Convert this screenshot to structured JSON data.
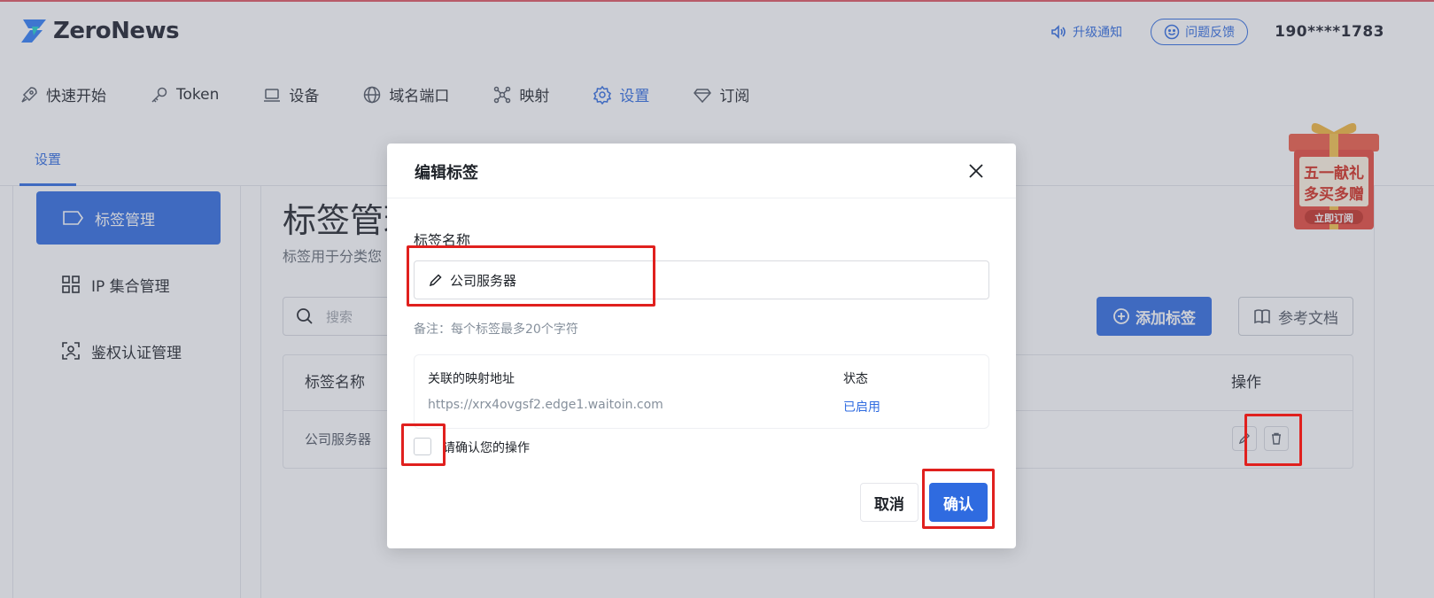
{
  "app": {
    "name": "ZeroNews"
  },
  "header": {
    "notice_label": "升级通知",
    "feedback_label": "问题反馈",
    "user_phone": "190****1783"
  },
  "nav": {
    "items": [
      {
        "label": "快速开始",
        "icon": "rocket-icon"
      },
      {
        "label": "Token",
        "icon": "key-icon"
      },
      {
        "label": "设备",
        "icon": "laptop-icon"
      },
      {
        "label": "域名端口",
        "icon": "globe-icon"
      },
      {
        "label": "映射",
        "icon": "network-icon"
      },
      {
        "label": "设置",
        "icon": "gear-icon",
        "active": true
      },
      {
        "label": "订阅",
        "icon": "diamond-icon"
      }
    ]
  },
  "subnav": {
    "tab": "设置"
  },
  "promo": {
    "line1": "五一献礼",
    "line2": "多买多赠",
    "cta": "立即订阅"
  },
  "sidebar": {
    "items": [
      {
        "label": "标签管理",
        "icon": "tag-icon",
        "active": true
      },
      {
        "label": "IP 集合管理",
        "icon": "grid-icon"
      },
      {
        "label": "鉴权认证管理",
        "icon": "user-scan-icon"
      }
    ]
  },
  "main": {
    "title": "标签管理",
    "subtitle": "标签用于分类您",
    "search_placeholder": "搜索",
    "add_button": "添加标签",
    "doc_button": "参考文档",
    "table": {
      "columns": [
        "标签名称",
        "操作"
      ],
      "rows": [
        {
          "name": "公司服务器"
        }
      ]
    }
  },
  "modal": {
    "title": "编辑标签",
    "field_label": "标签名称",
    "field_value": "公司服务器",
    "hint": "备注：每个标签最多20个字符",
    "mapping": {
      "col_address": "关联的映射地址",
      "col_status": "状态",
      "address": "https://xrx4ovgsf2.edge1.waitoin.com",
      "status": "已启用"
    },
    "confirm_checkbox_label": "请确认您的操作",
    "cancel_label": "取消",
    "ok_label": "确认"
  },
  "colors": {
    "accent": "#2f6be0",
    "highlight": "#e0201e",
    "promo_red": "#e8473a"
  }
}
